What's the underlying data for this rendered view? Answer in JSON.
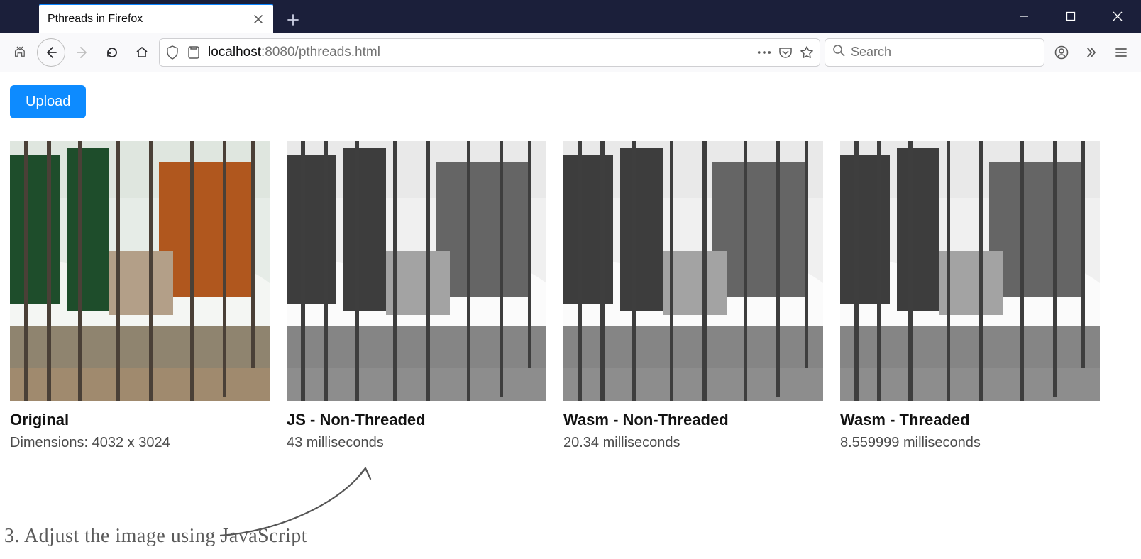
{
  "browser": {
    "tab_title": "Pthreads in Firefox",
    "url_host": "localhost",
    "url_port_path": ":8080/pthreads.html",
    "search_placeholder": "Search"
  },
  "page": {
    "upload_label": "Upload",
    "cards": [
      {
        "title": "Original",
        "subtitle": "Dimensions: 4032 x 3024"
      },
      {
        "title": "JS - Non-Threaded",
        "subtitle": "43 milliseconds"
      },
      {
        "title": "Wasm - Non-Threaded",
        "subtitle": "20.34 milliseconds"
      },
      {
        "title": "Wasm - Threaded",
        "subtitle": "8.559999 milliseconds"
      }
    ]
  },
  "annotation": {
    "caption": "3. Adjust the image using JavaScript"
  }
}
